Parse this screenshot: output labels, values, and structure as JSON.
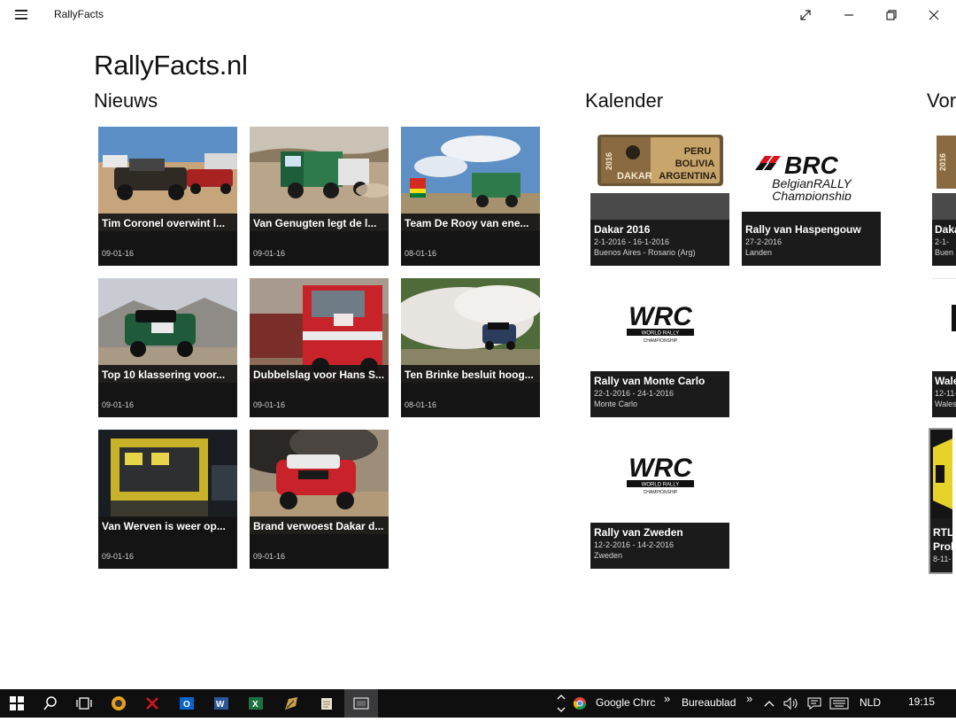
{
  "window": {
    "title": "RallyFacts"
  },
  "page": {
    "title": "RallyFacts.nl"
  },
  "sections": {
    "news": "Nieuws",
    "calendar": "Kalender",
    "third": "Vor"
  },
  "news": [
    {
      "title": "Tim Coronel overwint l...",
      "date": "09-01-16"
    },
    {
      "title": "Van Genugten legt de l...",
      "date": "09-01-16"
    },
    {
      "title": "Team De Rooy van ene...",
      "date": "08-01-16"
    },
    {
      "title": "Top 10 klassering voor...",
      "date": "09-01-16"
    },
    {
      "title": "Dubbelslag voor Hans S...",
      "date": "09-01-16"
    },
    {
      "title": "Ten Brinke besluit hoog...",
      "date": "08-01-16"
    },
    {
      "title": "Van Werven is weer op...",
      "date": "09-01-16"
    },
    {
      "title": "Brand verwoest Dakar d...",
      "date": "09-01-16"
    }
  ],
  "calendar": [
    {
      "title": "Dakar 2016",
      "dates": "2-1-2016 - 16-1-2016",
      "location": "Buenos Aires - Rosario (Arg)",
      "logo": {
        "year": "2016",
        "brand": "DAKAR",
        "line1": "PERU",
        "line2": "BOLIVIA",
        "line3": "ARGENTINA"
      }
    },
    {
      "title": "Rally van Haspengouw",
      "dates": "27-2-2016",
      "location": "Landen",
      "logo": {
        "brand": "BRC",
        "line1": "BelgianRALLY",
        "line2": "Championship"
      }
    },
    {
      "title": "Rally van Monte Carlo",
      "dates": "22-1-2016 - 24-1-2016",
      "location": "Monte Carlo",
      "logo": {
        "brand": "WRC",
        "sub": "WORLD RALLY",
        "sub2": "CHAMPIONSHIP"
      }
    },
    {
      "title": "Rally van Zweden",
      "dates": "12-2-2016 - 14-2-2016",
      "location": "Zweden",
      "logo": {
        "brand": "WRC",
        "sub": "WORLD RALLY",
        "sub2": "CHAMPIONSHIP"
      }
    }
  ],
  "partial": [
    {
      "title": "Daka",
      "d1": "2-1-",
      "d2": "Buen",
      "logo_year": "2016"
    },
    {
      "title": "Wale",
      "d1": "12-11-",
      "d2": "Wales"
    },
    {
      "title": "RTL",
      "d1": "Prolo",
      "d2": "8-11-"
    }
  ],
  "taskbar": {
    "chrome_label": "Google Chrc",
    "desktop_label": "Bureaublad",
    "more1": "»",
    "more2": "»",
    "language": "NLD",
    "time": "19:15"
  },
  "colors": {
    "tile": "#1b1b1b",
    "taskbar": "#0f0f10",
    "dakar_tan": "#c8a66b",
    "brc_red": "#d7141a"
  }
}
